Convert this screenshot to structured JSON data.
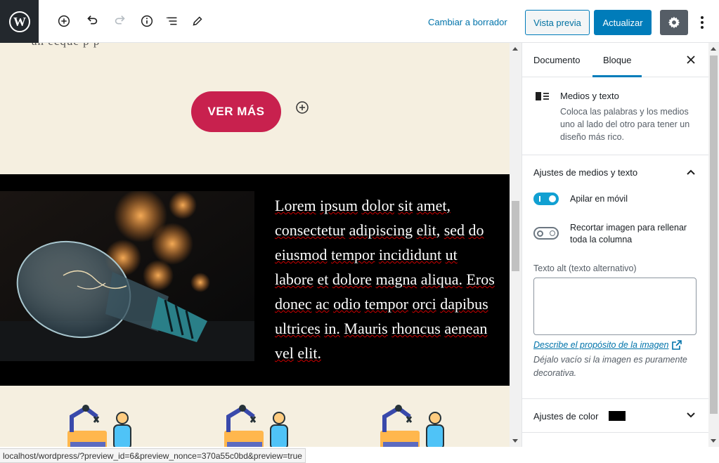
{
  "toolbar": {
    "switch_draft": "Cambiar a borrador",
    "preview": "Vista previa",
    "update": "Actualizar",
    "icons": [
      "wordpress-icon",
      "add-block-icon",
      "undo-icon",
      "redo-icon",
      "info-icon",
      "list-view-icon",
      "edit-icon",
      "gear-icon",
      "more-vertical-icon"
    ]
  },
  "canvas": {
    "cut_text": "an ecque                                      p                         p",
    "button": "VER MÁS",
    "paragraph_words": [
      "Lorem",
      "ipsum",
      "dolor",
      "sit",
      "amet,",
      "consectetur",
      "adipiscing",
      "elit,",
      "sed",
      "do",
      "eiusmod",
      "tempor",
      "incididunt",
      "ut",
      "labore",
      "et",
      "dolore",
      "magna",
      "aliqua.",
      "Eros",
      "donec",
      "ac",
      "odio",
      "tempor",
      "orci",
      "dapibus",
      "ultrices",
      "in.",
      "Mauris",
      "rhoncus",
      "aenean",
      "vel",
      "elit."
    ]
  },
  "sidebar": {
    "tabs": [
      "Documento",
      "Bloque"
    ],
    "active_tab": "Bloque",
    "block": {
      "title": "Medios y texto",
      "description": "Coloca las palabras y los medios uno al lado del otro para tener un diseño más rico."
    },
    "media_settings": {
      "title": "Ajustes de medios y texto",
      "stack_label": "Apilar en móvil",
      "stack_on": true,
      "crop_label": "Recortar imagen para rellenar toda la columna",
      "crop_on": false,
      "alt_label": "Texto alt (texto alternativo)",
      "alt_value": "",
      "alt_link": "Describe el propósito de la imagen",
      "alt_help": "Déjalo vacío si la imagen es puramente decorativa."
    },
    "color_settings": {
      "title": "Ajustes de color",
      "swatch": "#000000"
    }
  },
  "status_url": "localhost/wordpress/?preview_id=6&preview_nonce=370a55c0bd&preview=true",
  "colors": {
    "accent": "#007cba",
    "button": "#c8214e",
    "canvas_bg": "#f5efe0"
  }
}
